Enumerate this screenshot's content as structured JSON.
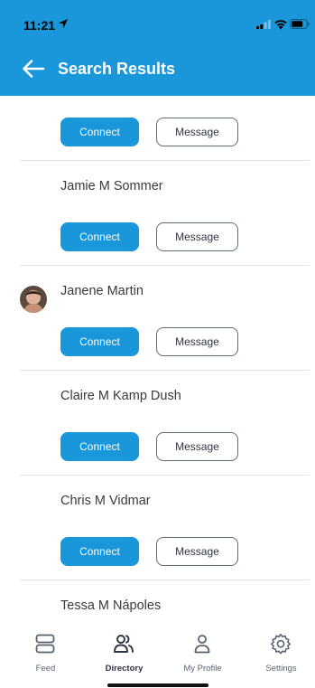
{
  "status_bar": {
    "time": "11:21"
  },
  "header": {
    "title": "Search Results"
  },
  "actions": {
    "connect_label": "Connect",
    "message_label": "Message"
  },
  "results": [
    {
      "name": ""
    },
    {
      "name": "Jamie M Sommer"
    },
    {
      "name": "Janene Martin",
      "has_avatar": true
    },
    {
      "name": "Claire M Kamp Dush"
    },
    {
      "name": "Chris M Vidmar"
    },
    {
      "name": "Tessa M Nápoles"
    }
  ],
  "tabs": [
    {
      "label": "Feed",
      "icon": "feed-icon",
      "active": false
    },
    {
      "label": "Directory",
      "icon": "directory-icon",
      "active": true
    },
    {
      "label": "My Profile",
      "icon": "profile-icon",
      "active": false
    },
    {
      "label": "Settings",
      "icon": "gear-icon",
      "active": false
    }
  ],
  "colors": {
    "accent": "#1a97da",
    "button_outline": "#5b6b7a",
    "divider": "#e3e3e3"
  }
}
